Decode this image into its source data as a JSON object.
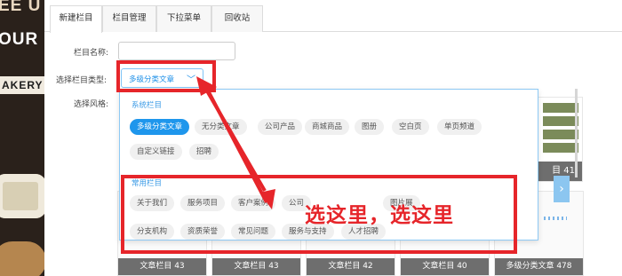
{
  "background_photo": {
    "text_top": "EE U",
    "text_mid": "OUR",
    "text_sign": "AKERY"
  },
  "tabs": [
    {
      "label": "新建栏目",
      "active": true
    },
    {
      "label": "栏目管理",
      "active": false
    },
    {
      "label": "下拉菜单",
      "active": false
    },
    {
      "label": "回收站",
      "active": false
    }
  ],
  "form": {
    "name_label": "栏目名称:",
    "name_value": "",
    "type_label": "选择栏目类型:",
    "type_selected": "多级分类文章",
    "style_label": "选择风格:"
  },
  "dropdown": {
    "system_title": "系统栏目",
    "system_items": [
      "多级分类文章",
      "无分类文章",
      "公司产品",
      "商城商品",
      "图册",
      "空白页",
      "单页频道",
      "自定义链接",
      "招聘"
    ],
    "common_title": "常用栏目",
    "common_items": [
      "关于我们",
      "服务项目",
      "客户案例",
      "公司",
      "图片展",
      "分支机构",
      "资质荣誉",
      "常见问题",
      "服务与支持",
      "人才招聘"
    ]
  },
  "thumbnails": {
    "right_top_caption": "目 41",
    "bottom_captions": [
      "文章栏目 43",
      "文章栏目 43",
      "文章栏目 42",
      "文章栏目 40",
      "多级分类文章 478"
    ]
  },
  "annotation": {
    "callout_text": "选这里，选这里",
    "color": "#e6252a"
  },
  "colors": {
    "accent": "#1e96ec",
    "annotation": "#e6252a"
  }
}
